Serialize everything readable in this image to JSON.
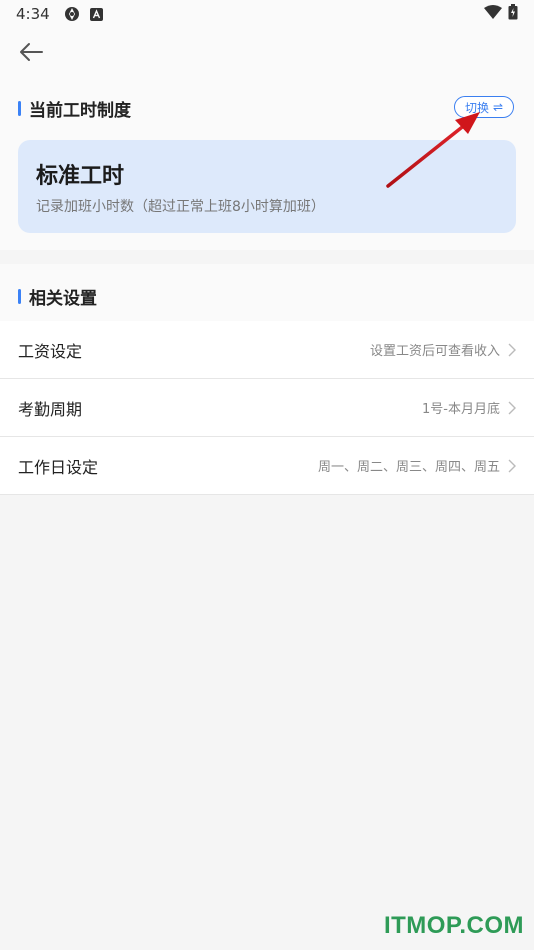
{
  "status_bar": {
    "time": "4:34"
  },
  "section_current": {
    "title": "当前工时制度",
    "switch_label": "切换",
    "switch_icon": "⇌",
    "card": {
      "title": "标准工时",
      "description": "记录加班小时数（超过正常上班8小时算加班）"
    }
  },
  "section_settings": {
    "title": "相关设置",
    "rows": [
      {
        "label": "工资设定",
        "value": "设置工资后可查看收入"
      },
      {
        "label": "考勤周期",
        "value": "1号-本月月底"
      },
      {
        "label": "工作日设定",
        "value": "周一、周二、周三、周四、周五"
      }
    ]
  },
  "watermark": "ITMOP.COM",
  "colors": {
    "accent": "#3b7ff0",
    "card_bg": "#dde9fb",
    "annotation_arrow": "#d0161b",
    "watermark": "#2e9b57"
  }
}
